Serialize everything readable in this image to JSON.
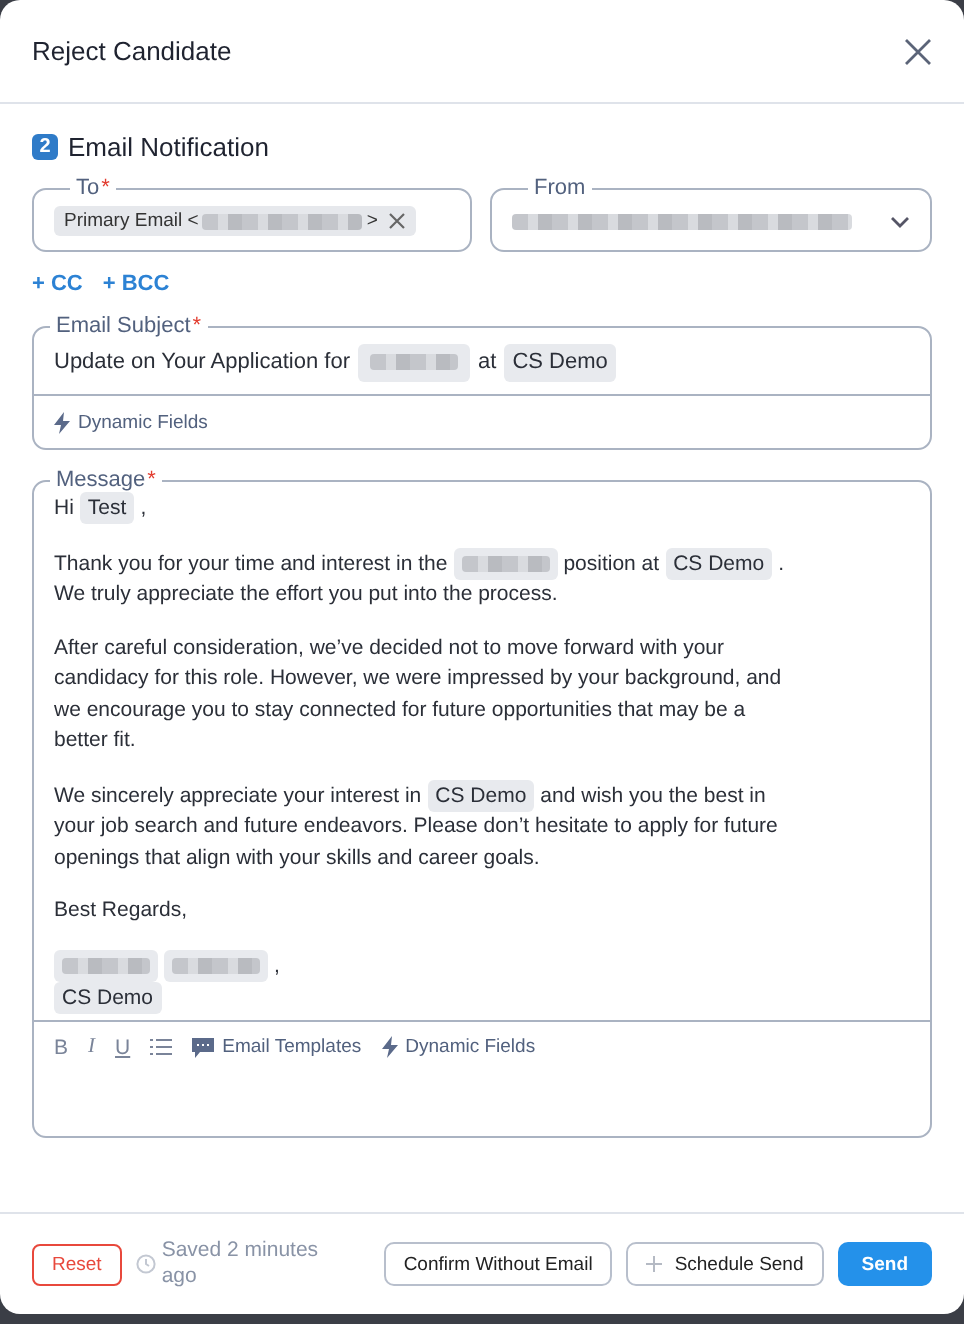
{
  "dialog": {
    "title": "Reject Candidate"
  },
  "required_mark": "*",
  "section": {
    "step": "2",
    "title": "Email Notification"
  },
  "to": {
    "label": "To",
    "required": true,
    "chips": [
      {
        "segments": [
          {
            "kind": "text",
            "text": "Primary Email <"
          },
          {
            "kind": "redacted"
          },
          {
            "kind": "text",
            "text": ">"
          }
        ]
      }
    ]
  },
  "from": {
    "label": "From",
    "required": false,
    "value": {
      "kind": "redacted"
    }
  },
  "links": [
    "+ CC",
    "+ BCC"
  ],
  "subject": {
    "label": "Email Subject",
    "required": true,
    "segments": [
      {
        "kind": "text",
        "text": "Update on Your Application for"
      },
      {
        "kind": "redacted"
      },
      {
        "kind": "text",
        "text": "at"
      },
      {
        "kind": "field",
        "text": "CS Demo"
      }
    ],
    "tools": [
      {
        "kind": "dynamic",
        "label": "Dynamic Fields"
      }
    ]
  },
  "message": {
    "label": "Message",
    "required": true,
    "paragraphs": [
      [
        {
          "kind": "text",
          "text": "Hi"
        },
        {
          "kind": "field",
          "text": "Test"
        },
        {
          "kind": "text",
          "text": ","
        }
      ],
      [
        {
          "kind": "text",
          "text": "Thank you for your time and interest in the"
        },
        {
          "kind": "redacted"
        },
        {
          "kind": "text",
          "text": "position at"
        },
        {
          "kind": "field",
          "text": "CS Demo"
        },
        {
          "kind": "text",
          "text": "."
        },
        {
          "kind": "break"
        },
        {
          "kind": "text",
          "text": "We truly appreciate the effort you put into the process."
        }
      ],
      [
        {
          "kind": "text",
          "text": "After careful consideration, we’ve decided not to move forward with your"
        },
        {
          "kind": "break"
        },
        {
          "kind": "text",
          "text": "candidacy for this role. However, we were impressed by your background, and"
        },
        {
          "kind": "break"
        },
        {
          "kind": "text",
          "text": "we encourage you to stay connected for future opportunities that may be a"
        },
        {
          "kind": "break"
        },
        {
          "kind": "text",
          "text": "better fit."
        }
      ],
      [
        {
          "kind": "text",
          "text": "We sincerely appreciate your interest in"
        },
        {
          "kind": "field",
          "text": "CS Demo"
        },
        {
          "kind": "text",
          "text": "and wish you the best in"
        },
        {
          "kind": "break"
        },
        {
          "kind": "text",
          "text": "your job search and future endeavors. Please don’t hesitate to apply for future"
        },
        {
          "kind": "break"
        },
        {
          "kind": "text",
          "text": "openings that align with your skills and career goals."
        }
      ],
      [
        {
          "kind": "text",
          "text": "Best Regards,"
        }
      ],
      [
        {
          "kind": "redacted"
        },
        {
          "kind": "redacted"
        },
        {
          "kind": "text",
          "text": ","
        },
        {
          "kind": "break"
        },
        {
          "kind": "field",
          "text": "CS Demo"
        }
      ]
    ],
    "toolbar": [
      {
        "kind": "bold",
        "glyph": "B"
      },
      {
        "kind": "italic",
        "glyph": "I"
      },
      {
        "kind": "underline",
        "glyph": "U"
      },
      {
        "kind": "list"
      },
      {
        "kind": "templates",
        "label": "Email Templates"
      },
      {
        "kind": "dynamic",
        "label": "Dynamic Fields"
      }
    ]
  },
  "footer": {
    "reset": "Reset",
    "saved": "Saved 2 minutes ago",
    "buttons": [
      {
        "kind": "outline",
        "label": "Confirm Without Email"
      },
      {
        "kind": "schedule",
        "label": "Schedule Send"
      },
      {
        "kind": "primary",
        "label": "Send"
      }
    ]
  }
}
